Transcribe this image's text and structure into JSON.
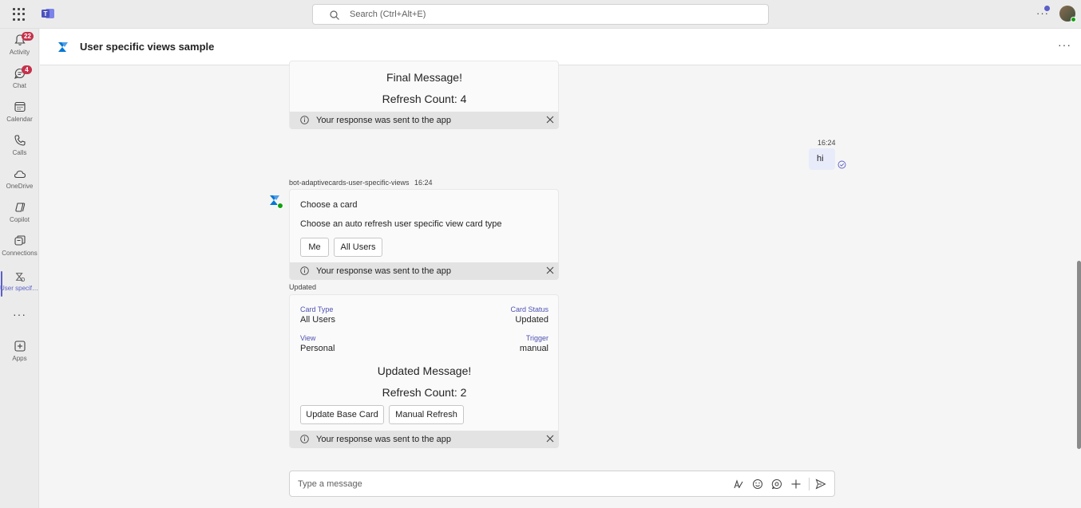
{
  "search": {
    "placeholder": "Search (Ctrl+Alt+E)"
  },
  "header": {
    "title": "User specific views sample"
  },
  "rail": {
    "items": [
      {
        "label": "Activity",
        "badge": "22"
      },
      {
        "label": "Chat",
        "badge": "4"
      },
      {
        "label": "Calendar"
      },
      {
        "label": "Calls"
      },
      {
        "label": "OneDrive"
      },
      {
        "label": "Copilot"
      },
      {
        "label": "Connections"
      },
      {
        "label": "User specific..."
      },
      {
        "label": "Apps"
      }
    ]
  },
  "messages": {
    "card1": {
      "title": "Final Message!",
      "refresh": "Refresh Count: 4",
      "footer": "Your response was sent to the app"
    },
    "user_msg": {
      "time": "16:24",
      "text": "hi"
    },
    "bot_meta": {
      "sender": "bot-adaptivecards-user-specific-views",
      "time": "16:24"
    },
    "card2": {
      "heading": "Choose a card",
      "subtext": "Choose an auto refresh user specific view card type",
      "btn_me": "Me",
      "btn_all": "All Users",
      "footer": "Your response was sent to the app"
    },
    "updated_label": "Updated",
    "card3": {
      "card_type_label": "Card Type",
      "card_type_value": "All Users",
      "card_status_label": "Card Status",
      "card_status_value": "Updated",
      "view_label": "View",
      "view_value": "Personal",
      "trigger_label": "Trigger",
      "trigger_value": "manual",
      "title": "Updated Message!",
      "refresh": "Refresh Count: 2",
      "btn_update": "Update Base Card",
      "btn_manual": "Manual Refresh",
      "footer": "Your response was sent to the app"
    }
  },
  "compose": {
    "placeholder": "Type a message"
  }
}
